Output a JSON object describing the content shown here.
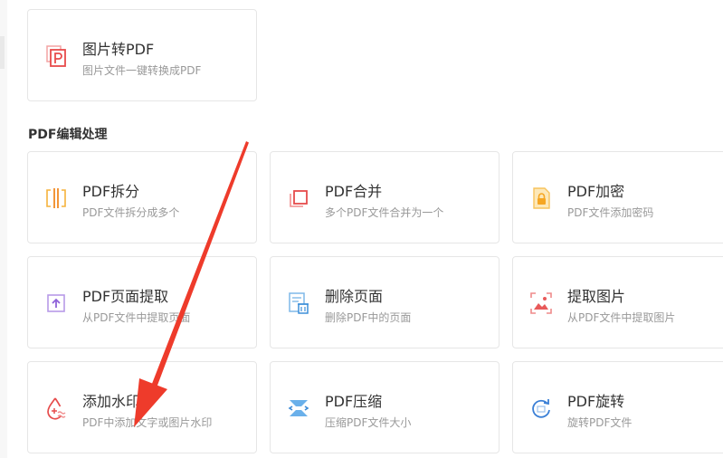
{
  "top_card": {
    "title": "图片转PDF",
    "desc": "图片文件一键转换成PDF",
    "icon": "image-to-pdf-icon"
  },
  "section": {
    "title": "PDF编辑处理",
    "cards": [
      {
        "title": "PDF拆分",
        "desc": "PDF文件拆分成多个",
        "icon": "split-icon"
      },
      {
        "title": "PDF合并",
        "desc": "多个PDF文件合并为一个",
        "icon": "merge-icon"
      },
      {
        "title": "PDF加密",
        "desc": "PDF文件添加密码",
        "icon": "lock-icon"
      },
      {
        "title": "PDF页面提取",
        "desc": "从PDF文件中提取页面",
        "icon": "extract-page-icon"
      },
      {
        "title": "删除页面",
        "desc": "删除PDF中的页面",
        "icon": "delete-page-icon"
      },
      {
        "title": "提取图片",
        "desc": "从PDF文件中提取图片",
        "icon": "extract-image-icon"
      },
      {
        "title": "添加水印",
        "desc": "PDF中添加文字或图片水印",
        "icon": "watermark-icon"
      },
      {
        "title": "PDF压缩",
        "desc": "压缩PDF文件大小",
        "icon": "compress-icon"
      },
      {
        "title": "PDF旋转",
        "desc": "旋转PDF文件",
        "icon": "rotate-icon"
      }
    ]
  },
  "colors": {
    "accent_red": "#ee3b2b",
    "text": "#333333",
    "muted": "#999999"
  }
}
